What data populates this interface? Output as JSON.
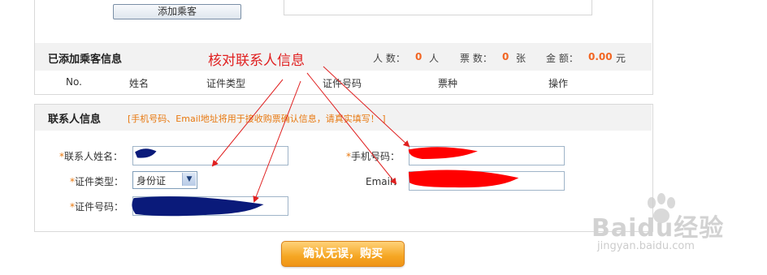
{
  "top": {
    "add_passenger_button": "添加乘客"
  },
  "passenger_section": {
    "title": "已添加乘客信息",
    "annotation": "核对联系人信息",
    "stats": {
      "people_label": "人 数：",
      "people_value": "0",
      "people_unit": "人",
      "tickets_label": "票 数：",
      "tickets_value": "0",
      "tickets_unit": "张",
      "amount_label": "金 额：",
      "amount_value": "0.00",
      "amount_unit": "元"
    },
    "columns": [
      "No.",
      "姓名",
      "证件类型",
      "证件号码",
      "票种",
      "操作"
    ]
  },
  "contact_section": {
    "title": "联系人信息",
    "note": "[手机号码、Email地址将用于接收购票确认信息，请真实填写！ ]",
    "required_mark": "*",
    "name_label": "联系人姓名：",
    "id_type_label": "证件类型：",
    "id_type_value": "身份证",
    "id_number_label": "证件号码：",
    "phone_label": "手机号码：",
    "email_label": "Email："
  },
  "buy_button": "确认无误，购买",
  "watermark": {
    "brand": "Baidu经验",
    "url": "jingyan.baidu.com"
  },
  "colors": {
    "accent_orange": "#f26522",
    "annotation_red": "#e02020",
    "redaction_blue": "#0a1a7a",
    "redaction_red": "#ff0000"
  }
}
